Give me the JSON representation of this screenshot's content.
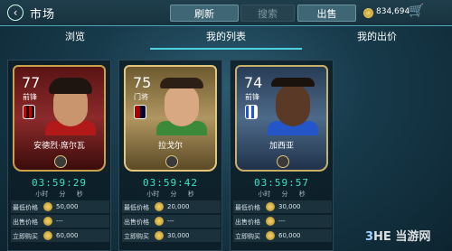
{
  "header": {
    "back_icon": "back-arrow-icon",
    "title": "市场",
    "refresh_label": "刷新",
    "search_label": "搜索",
    "sell_label": "出售",
    "coins": "834,694",
    "cart_icon": "cart-icon"
  },
  "tabs": [
    {
      "label": "浏览"
    },
    {
      "label": "我的列表"
    },
    {
      "label": "我的出价"
    }
  ],
  "cards": [
    {
      "rating": "77",
      "position": "前锋",
      "name": "安德烈·席尔瓦",
      "timer": "03:59:29",
      "units": "小时 分 秒",
      "min_label": "最低价格",
      "min_value": "50,000",
      "bid_label": "出售价格",
      "bid_value": "---",
      "buy_label": "立即购买",
      "buy_value": "60,000"
    },
    {
      "rating": "75",
      "position": "门将",
      "name": "拉戈尔",
      "timer": "03:59:42",
      "units": "小时 分 秒",
      "min_label": "最低价格",
      "min_value": "20,000",
      "bid_label": "出售价格",
      "bid_value": "---",
      "buy_label": "立即购买",
      "buy_value": "30,000"
    },
    {
      "rating": "74",
      "position": "前锋",
      "name": "加西亚",
      "timer": "03:59:57",
      "units": "小时 分 秒",
      "min_label": "最低价格",
      "min_value": "30,000",
      "bid_label": "出售价格",
      "bid_value": "---",
      "buy_label": "立即购买",
      "buy_value": "60,000"
    }
  ],
  "watermark": {
    "part1": "3",
    "part2": "HE",
    "part3": "当游网"
  },
  "colors": {
    "accent": "#4fd0e0",
    "timer": "#39e3c5"
  }
}
